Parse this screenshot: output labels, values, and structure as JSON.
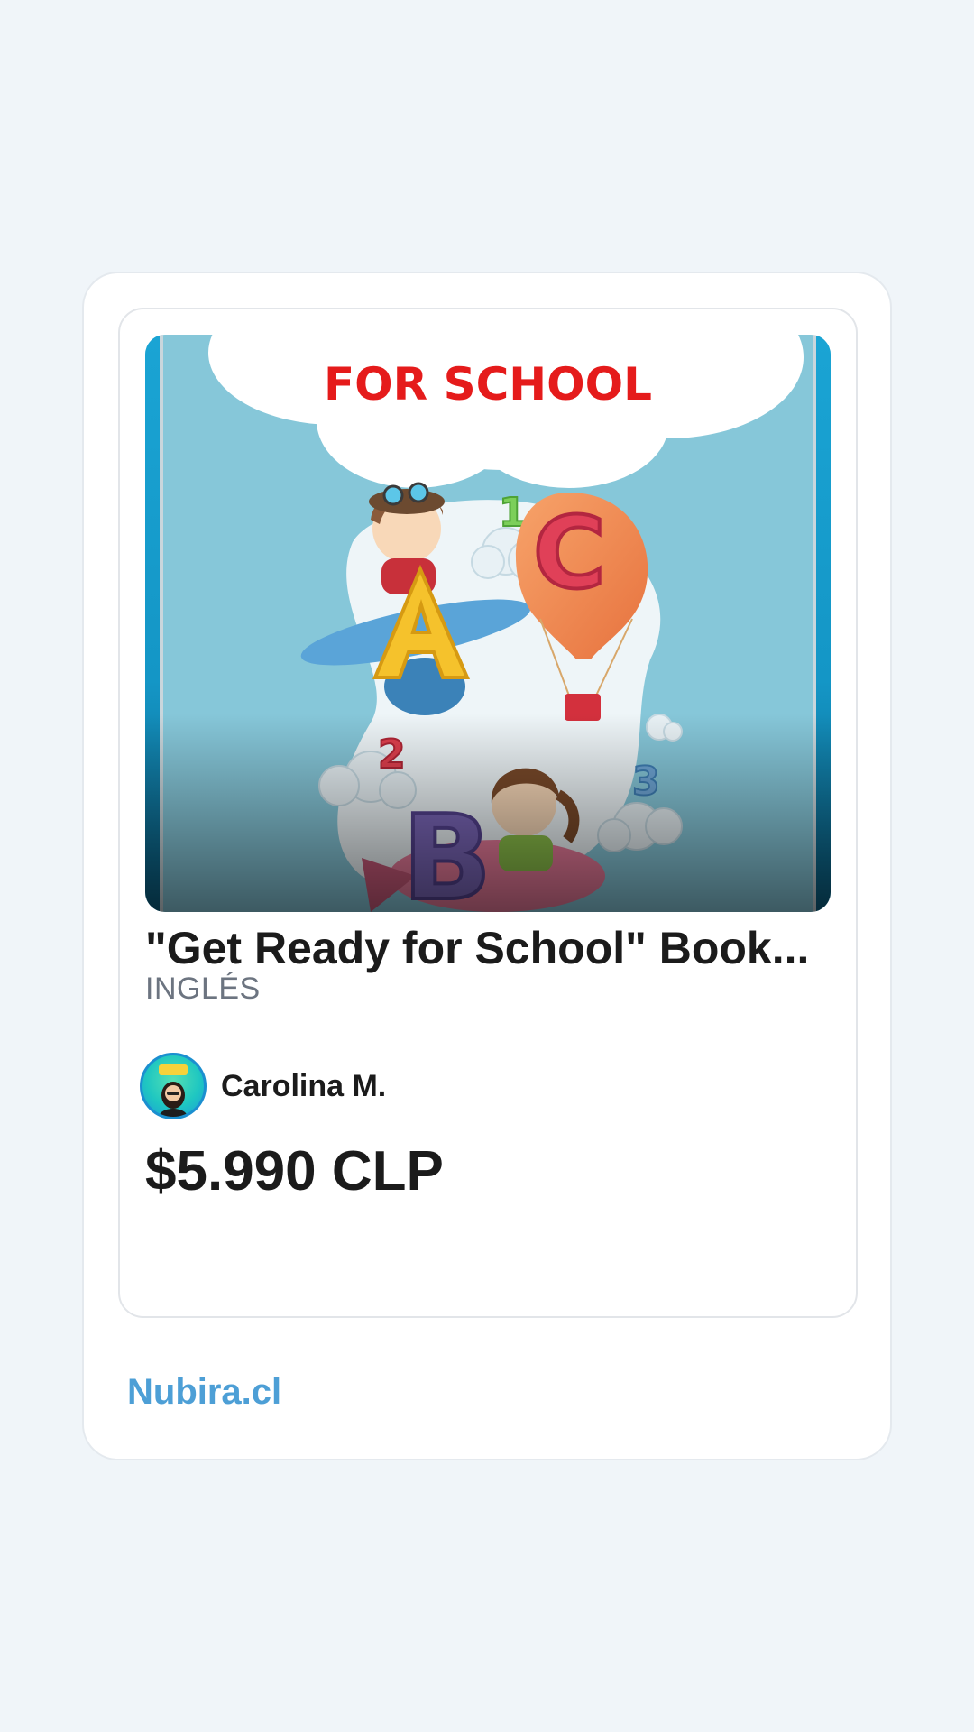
{
  "product": {
    "cover_heading": "FOR SCHOOL",
    "cover_numbers": [
      "1",
      "2",
      "3"
    ],
    "cover_letters": [
      "A",
      "B",
      "C"
    ],
    "title": "\"Get Ready for School\" Book...",
    "subject": "INGLÉS",
    "seller_name": "Carolina M.",
    "price": "$5.990 CLP"
  },
  "footer": {
    "brand": "Nubira.cl"
  },
  "colors": {
    "page_background": "#f0f5f9",
    "brand_link": "#4d9fd6",
    "cover_sky": "#86c7d9",
    "cover_heading": "#e51b1b"
  }
}
